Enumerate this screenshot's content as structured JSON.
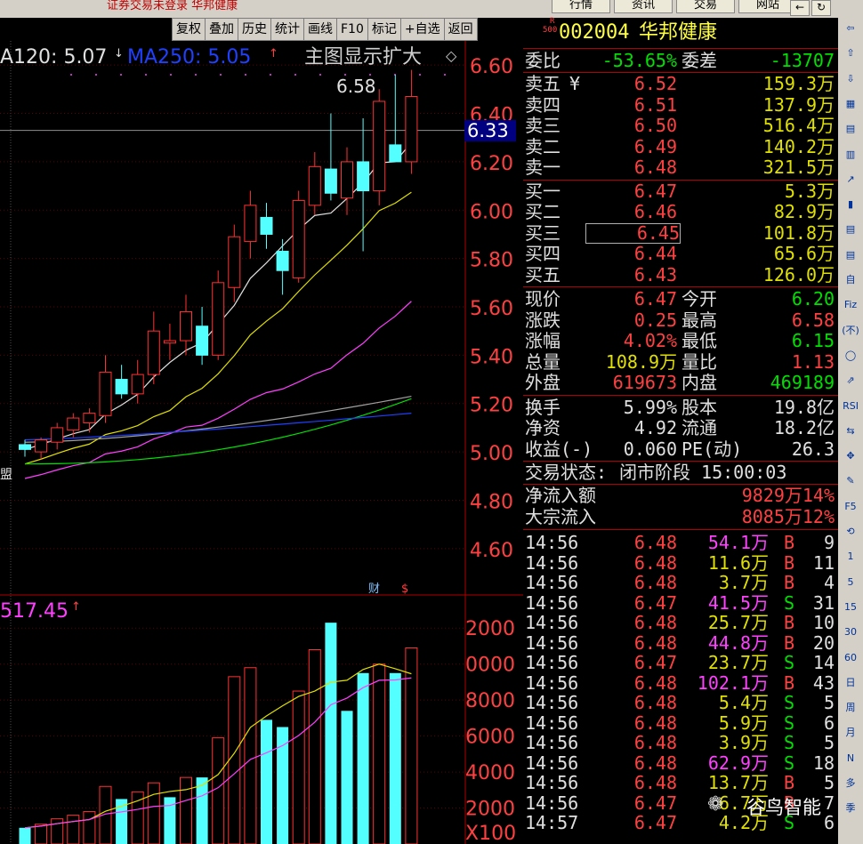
{
  "topbar": {
    "login_status": "证券交易未登录  华邦健康",
    "tabs": [
      "行情",
      "资讯",
      "交易",
      "网站"
    ],
    "window_buttons": [
      "←",
      "↻"
    ]
  },
  "toolbar": {
    "buttons": [
      "复权",
      "叠加",
      "历史",
      "统计",
      "画线",
      "F10",
      "标记",
      "+自选",
      "返回"
    ]
  },
  "chart": {
    "title": "主图显示扩大",
    "ma120_label": "A120: 5.07",
    "ma250_label": "MA250: 5.05",
    "high_annotation": "6.58",
    "crosshair_price": "6.33",
    "vol_ma_label": "517.45",
    "left_edge_text": "盟",
    "event_icons": [
      "财",
      "$"
    ],
    "price_axis": [
      "6.60",
      "6.40",
      "6.20",
      "6.00",
      "5.80",
      "5.60",
      "5.40",
      "5.20",
      "5.00",
      "4.80",
      "4.60"
    ],
    "volume_axis": [
      "2000",
      "0000",
      "8000",
      "6000",
      "4000",
      "2000",
      "X100"
    ],
    "colors": {
      "up": "#ff3030",
      "down": "#54ffff",
      "ma5": "#e0e0e0",
      "ma10": "#e0e000",
      "ma20": "#ff40ff",
      "ma60": "#00e000",
      "ma120": "#a0a0a0",
      "ma250": "#2040ff"
    }
  },
  "chart_data": {
    "type": "candlestick",
    "price_axis_range": [
      4.5,
      6.7
    ],
    "candles": [
      {
        "o": 5.03,
        "h": 5.05,
        "l": 4.98,
        "c": 5.01
      },
      {
        "o": 5.0,
        "h": 5.06,
        "l": 4.97,
        "c": 5.05
      },
      {
        "o": 5.04,
        "h": 5.12,
        "l": 5.01,
        "c": 5.1
      },
      {
        "o": 5.09,
        "h": 5.16,
        "l": 5.06,
        "c": 5.14
      },
      {
        "o": 5.12,
        "h": 5.18,
        "l": 5.08,
        "c": 5.16
      },
      {
        "o": 5.15,
        "h": 5.4,
        "l": 5.12,
        "c": 5.33
      },
      {
        "o": 5.3,
        "h": 5.36,
        "l": 5.22,
        "c": 5.24
      },
      {
        "o": 5.24,
        "h": 5.38,
        "l": 5.2,
        "c": 5.32
      },
      {
        "o": 5.32,
        "h": 5.58,
        "l": 5.28,
        "c": 5.5
      },
      {
        "o": 5.45,
        "h": 5.53,
        "l": 5.38,
        "c": 5.46
      },
      {
        "o": 5.46,
        "h": 5.65,
        "l": 5.4,
        "c": 5.58
      },
      {
        "o": 5.52,
        "h": 5.6,
        "l": 5.36,
        "c": 5.4
      },
      {
        "o": 5.4,
        "h": 5.75,
        "l": 5.38,
        "c": 5.7
      },
      {
        "o": 5.68,
        "h": 5.94,
        "l": 5.62,
        "c": 5.89
      },
      {
        "o": 5.87,
        "h": 6.08,
        "l": 5.8,
        "c": 6.02
      },
      {
        "o": 5.97,
        "h": 6.03,
        "l": 5.84,
        "c": 5.9
      },
      {
        "o": 5.83,
        "h": 5.88,
        "l": 5.65,
        "c": 5.75
      },
      {
        "o": 5.72,
        "h": 6.08,
        "l": 5.7,
        "c": 6.04
      },
      {
        "o": 6.02,
        "h": 6.24,
        "l": 5.98,
        "c": 6.18
      },
      {
        "o": 6.17,
        "h": 6.4,
        "l": 6.04,
        "c": 6.07
      },
      {
        "o": 6.05,
        "h": 6.26,
        "l": 5.98,
        "c": 6.2
      },
      {
        "o": 6.2,
        "h": 6.38,
        "l": 5.83,
        "c": 6.08
      },
      {
        "o": 6.08,
        "h": 6.5,
        "l": 6.02,
        "c": 6.45
      },
      {
        "o": 6.27,
        "h": 6.56,
        "l": 6.2,
        "c": 6.2
      },
      {
        "o": 6.2,
        "h": 6.58,
        "l": 6.15,
        "c": 6.47
      }
    ],
    "volume": [
      {
        "v": 900,
        "dir": "down"
      },
      {
        "v": 1100,
        "dir": "up"
      },
      {
        "v": 1400,
        "dir": "up"
      },
      {
        "v": 1600,
        "dir": "up"
      },
      {
        "v": 1800,
        "dir": "up"
      },
      {
        "v": 3200,
        "dir": "up"
      },
      {
        "v": 2500,
        "dir": "down"
      },
      {
        "v": 2900,
        "dir": "up"
      },
      {
        "v": 3400,
        "dir": "up"
      },
      {
        "v": 2600,
        "dir": "down"
      },
      {
        "v": 3700,
        "dir": "up"
      },
      {
        "v": 3700,
        "dir": "down"
      },
      {
        "v": 5900,
        "dir": "up"
      },
      {
        "v": 9300,
        "dir": "up"
      },
      {
        "v": 9800,
        "dir": "up"
      },
      {
        "v": 6900,
        "dir": "down"
      },
      {
        "v": 6500,
        "dir": "down"
      },
      {
        "v": 8500,
        "dir": "up"
      },
      {
        "v": 10800,
        "dir": "up"
      },
      {
        "v": 12300,
        "dir": "down"
      },
      {
        "v": 7400,
        "dir": "down"
      },
      {
        "v": 9500,
        "dir": "down"
      },
      {
        "v": 10000,
        "dir": "up"
      },
      {
        "v": 9500,
        "dir": "down"
      },
      {
        "v": 10900,
        "dir": "up"
      }
    ],
    "volume_axis_range": [
      0,
      13000
    ]
  },
  "quote": {
    "code": "002004",
    "name": "华邦健康",
    "badge_top": "R",
    "badge_bottom": "500",
    "weibi_label": "委比",
    "weibi": "-53.65%",
    "weicha_label": "委差",
    "weicha": "-13707",
    "yen": "¥",
    "asks": [
      {
        "label": "卖五",
        "price": "6.52",
        "vol": "159.3万"
      },
      {
        "label": "卖四",
        "price": "6.51",
        "vol": "137.9万"
      },
      {
        "label": "卖三",
        "price": "6.50",
        "vol": "516.4万"
      },
      {
        "label": "卖二",
        "price": "6.49",
        "vol": "140.2万"
      },
      {
        "label": "卖一",
        "price": "6.48",
        "vol": "321.5万"
      }
    ],
    "bids": [
      {
        "label": "买一",
        "price": "6.47",
        "vol": "5.3万"
      },
      {
        "label": "买二",
        "price": "6.46",
        "vol": "82.9万"
      },
      {
        "label": "买三",
        "price": "6.45",
        "vol": "101.8万"
      },
      {
        "label": "买四",
        "price": "6.44",
        "vol": "65.6万"
      },
      {
        "label": "买五",
        "price": "6.43",
        "vol": "126.0万"
      }
    ],
    "stats_a": [
      {
        "l1": "现价",
        "v1": "6.47",
        "c1": "r",
        "l2": "今开",
        "v2": "6.20",
        "c2": "g"
      },
      {
        "l1": "涨跌",
        "v1": "0.25",
        "c1": "r",
        "l2": "最高",
        "v2": "6.58",
        "c2": "r"
      },
      {
        "l1": "涨幅",
        "v1": "4.02%",
        "c1": "r",
        "l2": "最低",
        "v2": "6.15",
        "c2": "g"
      },
      {
        "l1": "总量",
        "v1": "108.9万",
        "c1": "y",
        "l2": "量比",
        "v2": "1.13",
        "c2": "r"
      },
      {
        "l1": "外盘",
        "v1": "619673",
        "c1": "r",
        "l2": "内盘",
        "v2": "469189",
        "c2": "g"
      }
    ],
    "stats_b": [
      {
        "l1": "换手",
        "v1": "5.99%",
        "l2": "股本",
        "v2": "19.8亿"
      },
      {
        "l1": "净资",
        "v1": "4.92",
        "l2": "流通",
        "v2": "18.2亿"
      },
      {
        "l1": "收益(-)",
        "v1": "0.060",
        "l2": "PE(动)",
        "v2": "26.3"
      }
    ],
    "status_label": "交易状态:",
    "status_value": "闭市阶段 15:00:03",
    "flows": [
      {
        "label": "净流入额",
        "value": "9829万14%"
      },
      {
        "label": "大宗流入",
        "value": "8085万12%"
      }
    ]
  },
  "ticks": [
    {
      "t": "14:56",
      "p": "6.48",
      "v": "54.1万",
      "vc": "m",
      "s": "B",
      "n": "9"
    },
    {
      "t": "14:56",
      "p": "6.48",
      "v": "11.6万",
      "vc": "y",
      "s": "B",
      "n": "11"
    },
    {
      "t": "14:56",
      "p": "6.48",
      "v": "3.7万",
      "vc": "y",
      "s": "B",
      "n": "4"
    },
    {
      "t": "14:56",
      "p": "6.47",
      "v": "41.5万",
      "vc": "m",
      "s": "S",
      "n": "31"
    },
    {
      "t": "14:56",
      "p": "6.48",
      "v": "25.7万",
      "vc": "y",
      "s": "B",
      "n": "10"
    },
    {
      "t": "14:56",
      "p": "6.48",
      "v": "44.8万",
      "vc": "m",
      "s": "B",
      "n": "20"
    },
    {
      "t": "14:56",
      "p": "6.47",
      "v": "23.7万",
      "vc": "y",
      "s": "S",
      "n": "14"
    },
    {
      "t": "14:56",
      "p": "6.48",
      "v": "102.1万",
      "vc": "m",
      "s": "B",
      "n": "43"
    },
    {
      "t": "14:56",
      "p": "6.48",
      "v": "5.4万",
      "vc": "y",
      "s": "S",
      "n": "5"
    },
    {
      "t": "14:56",
      "p": "6.48",
      "v": "5.9万",
      "vc": "y",
      "s": "S",
      "n": "6"
    },
    {
      "t": "14:56",
      "p": "6.48",
      "v": "3.9万",
      "vc": "y",
      "s": "S",
      "n": "5"
    },
    {
      "t": "14:56",
      "p": "6.48",
      "v": "62.9万",
      "vc": "m",
      "s": "S",
      "n": "18"
    },
    {
      "t": "14:56",
      "p": "6.48",
      "v": "13.7万",
      "vc": "y",
      "s": "B",
      "n": "5"
    },
    {
      "t": "14:56",
      "p": "6.47",
      "v": "6.7万",
      "vc": "y",
      "s": "B",
      "n": "7"
    },
    {
      "t": "14:57",
      "p": "6.47",
      "v": "4.2万",
      "vc": "y",
      "s": "S",
      "n": "6"
    }
  ],
  "sidebar": {
    "items": [
      "⇦",
      "⇧",
      "⇩",
      "▦",
      "▤",
      "▥",
      "↗",
      "▮",
      "▤",
      "▤",
      "自",
      "Fiz",
      "(不)",
      "◯",
      "⇗",
      "RSI",
      "⇆",
      "✥",
      "✎",
      "F5",
      "⟲",
      "1",
      "5",
      "15",
      "30",
      "60",
      "日",
      "周",
      "月",
      "N",
      "多",
      "季"
    ]
  },
  "watermark": "谷鸟智能"
}
